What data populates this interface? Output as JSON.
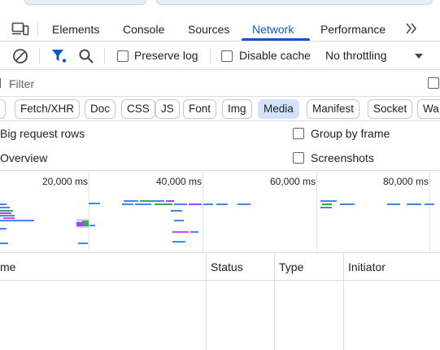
{
  "tabs": [
    {
      "label": "Elements"
    },
    {
      "label": "Console"
    },
    {
      "label": "Sources"
    },
    {
      "label": "Network"
    },
    {
      "label": "Performance"
    }
  ],
  "active_tab": "Network",
  "toolbar": {
    "preserve_log_label": "Preserve log",
    "disable_cache_label": "Disable cache",
    "throttling_value": "No throttling"
  },
  "filter": {
    "placeholder": "Filter"
  },
  "type_filters": [
    {
      "label": "Fetch/XHR",
      "active": false
    },
    {
      "label": "Doc",
      "active": false
    },
    {
      "label": "CSS",
      "active": false
    },
    {
      "label": "JS",
      "active": false
    },
    {
      "label": "Font",
      "active": false
    },
    {
      "label": "Img",
      "active": false
    },
    {
      "label": "Media",
      "active": true
    },
    {
      "label": "Manifest",
      "active": false
    },
    {
      "label": "Socket",
      "active": false
    },
    {
      "label": "Wa",
      "active": false
    }
  ],
  "settings": {
    "big_request_rows_label": "Big request rows",
    "overview_label": "Overview",
    "group_by_frame_label": "Group by frame",
    "screenshots_label": "Screenshots"
  },
  "overview": {
    "ticks": [
      {
        "label": "20,000 ms"
      },
      {
        "label": "40,000 ms"
      },
      {
        "label": "60,000 ms"
      },
      {
        "label": "80,000 ms"
      }
    ]
  },
  "table": {
    "columns": [
      {
        "label": "me"
      },
      {
        "label": "Status"
      },
      {
        "label": "Type"
      },
      {
        "label": "Initiator"
      }
    ]
  },
  "colors": {
    "accent": "#0b57d0",
    "chip_active_bg": "#d3e3fd",
    "bar_blue": "#4285f4",
    "bar_green": "#34a853",
    "bar_purple": "#a142f4",
    "bar_magenta": "#e040fb"
  },
  "icons": {
    "device_toggle": "device-toolbar-icon",
    "more_tabs": "chevron-double-right-icon",
    "clear": "clear-circle-icon",
    "filter": "filter-funnel-icon",
    "search": "search-icon",
    "dropdown": "caret-down-icon"
  }
}
